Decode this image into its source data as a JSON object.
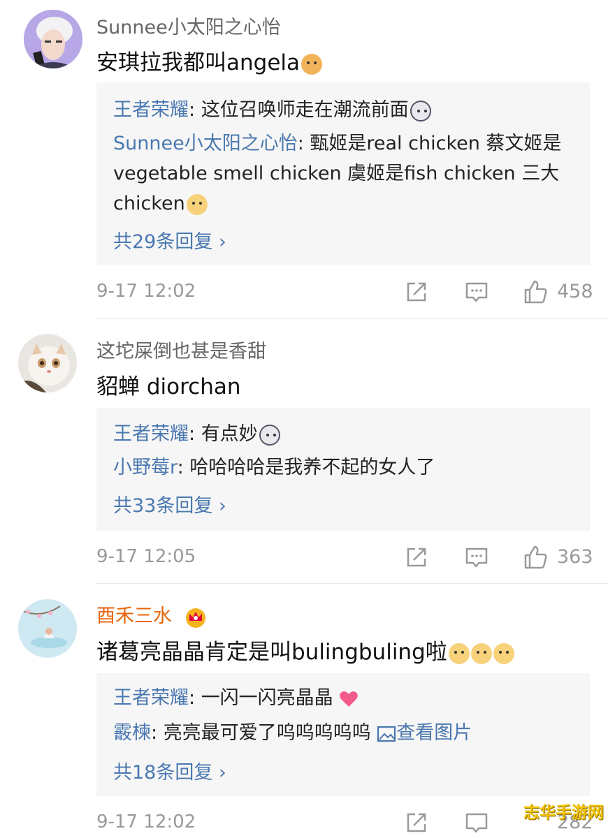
{
  "comments": [
    {
      "username": "Sunnee小太阳之心怡",
      "text": "安琪拉我都叫angela",
      "text_emojis": [
        "cat-emoji"
      ],
      "replies": [
        {
          "name": "王者荣耀",
          "sep": ": ",
          "text": "这位召唤师走在潮流前面"
        },
        {
          "name": "Sunnee小太阳之心怡",
          "sep": ": ",
          "text": "甄姬是real chicken 蔡文姬是 vegetable smell chicken 虞姬是fish chicken 三大 chicken"
        }
      ],
      "more": "共29条回复 ›",
      "time": "9-17 12:02",
      "likes": "458"
    },
    {
      "username": "这坨屎倒也甚是香甜",
      "text": "貂蝉 diorchan",
      "replies": [
        {
          "name": "王者荣耀",
          "sep": ": ",
          "text": "有点妙"
        },
        {
          "name": "小野莓r",
          "sep": ": ",
          "text": "哈哈哈哈是我养不起的女人了"
        }
      ],
      "more": "共33条回复 ›",
      "time": "9-17 12:05",
      "likes": "363"
    },
    {
      "username": "酉禾三水",
      "text": "诸葛亮晶晶肯定是叫bulingbuling啦",
      "replies": [
        {
          "name": "王者荣耀",
          "sep": ": ",
          "text": "一闪一闪亮晶晶"
        },
        {
          "name": "霰楝",
          "sep": ": ",
          "text": "亮亮最可爱了呜呜呜呜呜",
          "link": "查看图片"
        }
      ],
      "more": "共18条回复 ›",
      "time": "9-17 12:02",
      "likes": "282"
    }
  ],
  "watermark": "志华手游网",
  "colors": {
    "link_blue": "#4a78b0",
    "vip_orange": "#e8650a",
    "meta_gray": "#999999",
    "reply_bg": "#f6f6f6"
  }
}
